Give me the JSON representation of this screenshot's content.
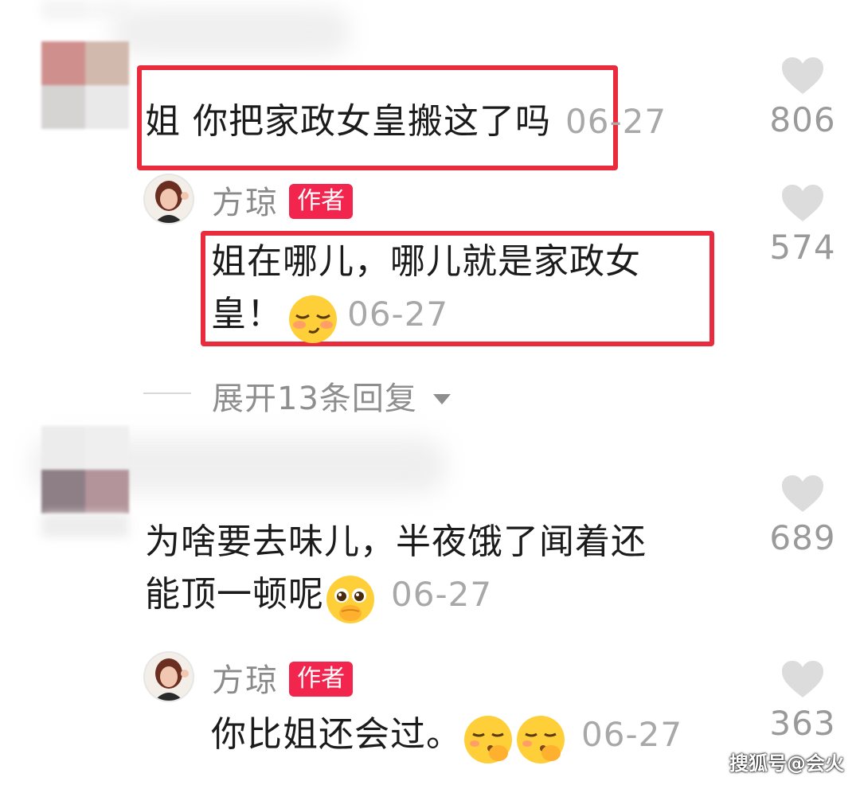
{
  "comments": [
    {
      "text": "姐 你把家政女皇搬这了吗",
      "date": "06-27",
      "likes": "806",
      "reply": {
        "author": "方琼",
        "badge": "作者",
        "text_line1": "姐在哪儿，哪儿就是家政女",
        "text_line2": "皇！",
        "emoji": "relieved-face",
        "date": "06-27",
        "likes": "574"
      },
      "expand_label": "展开13条回复"
    },
    {
      "text_line1": "为啥要去味儿，半夜饿了闻着还",
      "text_line2": "能顶一顿呢",
      "emoji": "pleading-face",
      "date": "06-27",
      "likes": "689",
      "reply": {
        "author": "方琼",
        "badge": "作者",
        "text": "你比姐还会过。",
        "emojis": [
          "kissing-face",
          "kissing-face"
        ],
        "date": "06-27",
        "likes": "363"
      }
    }
  ],
  "watermark": "搜狐号@会火",
  "colors": {
    "highlight": "#ea2a3d",
    "badge": "#f1254e",
    "muted": "#9a9a9a"
  }
}
